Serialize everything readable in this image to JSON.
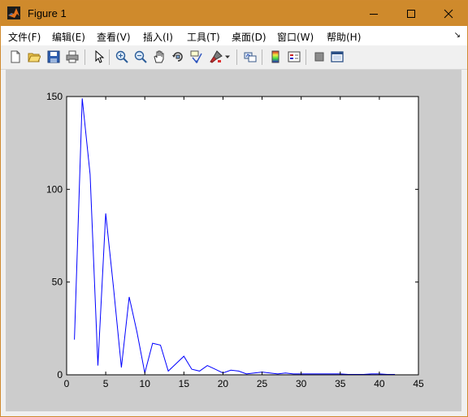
{
  "window": {
    "title": "Figure 1"
  },
  "menu": [
    "文件(F)",
    "编辑(E)",
    "查看(V)",
    "插入(I)",
    "工具(T)",
    "桌面(D)",
    "窗口(W)",
    "帮助(H)"
  ],
  "toolbar": {
    "icons": [
      "new-figure-icon",
      "open-file-icon",
      "save-icon",
      "print-icon",
      "edit-plot-arrow-icon",
      "zoom-in-icon",
      "zoom-out-icon",
      "pan-hand-icon",
      "rotate-3d-icon",
      "data-cursor-icon",
      "brush-icon",
      "brush-dropdown-icon",
      "link-plot-icon",
      "colorbar-icon",
      "legend-icon",
      "hide-plot-tools-icon",
      "show-plot-tools-icon"
    ]
  },
  "chart_data": {
    "type": "line",
    "title": "",
    "xlabel": "",
    "ylabel": "",
    "xlim": [
      0,
      45
    ],
    "ylim": [
      0,
      150
    ],
    "xticks": [
      0,
      5,
      10,
      15,
      20,
      25,
      30,
      35,
      40,
      45
    ],
    "yticks": [
      0,
      50,
      100,
      150
    ],
    "grid": false,
    "series": [
      {
        "color": "#0000ff",
        "x": [
          1,
          2,
          3,
          4,
          5,
          6,
          7,
          8,
          9,
          10,
          11,
          12,
          13,
          14,
          15,
          16,
          17,
          18,
          19,
          20,
          21,
          22,
          23,
          24,
          25,
          26,
          27,
          28,
          29,
          30,
          31,
          32,
          33,
          34,
          35,
          36,
          37,
          38,
          39,
          40,
          41,
          42
        ],
        "y": [
          19,
          149,
          108,
          5,
          87,
          47,
          4,
          42,
          23,
          1,
          17,
          16,
          2,
          6,
          10,
          3,
          2,
          5,
          3,
          1,
          2.5,
          2,
          0.5,
          1,
          1.5,
          1,
          0.5,
          1,
          0.5,
          0.5,
          0.5,
          0.5,
          0.5,
          0.5,
          0.5,
          0.2,
          0.2,
          0.2,
          0.5,
          0.5,
          0.2,
          0.2
        ]
      }
    ]
  }
}
